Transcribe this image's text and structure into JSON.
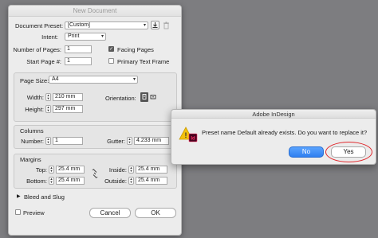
{
  "new_document": {
    "title": "New Document",
    "preset_label": "Document Preset:",
    "preset_value": "[Custom]",
    "intent_label": "Intent:",
    "intent_value": "Print",
    "pages_label": "Number of Pages:",
    "pages_value": "1",
    "start_page_label": "Start Page #:",
    "start_page_value": "1",
    "facing_pages_label": "Facing Pages",
    "facing_pages_checked": true,
    "primary_text_frame_label": "Primary Text Frame",
    "primary_text_frame_checked": false,
    "page_size_label": "Page Size:",
    "page_size_value": "A4",
    "width_label": "Width:",
    "width_value": "210 mm",
    "height_label": "Height:",
    "height_value": "297 mm",
    "orientation_label": "Orientation:",
    "columns_heading": "Columns",
    "number_label": "Number:",
    "number_value": "1",
    "gutter_label": "Gutter:",
    "gutter_value": "4.233 mm",
    "margins_heading": "Margins",
    "top_label": "Top:",
    "top_value": "25.4 mm",
    "bottom_label": "Bottom:",
    "bottom_value": "25.4 mm",
    "inside_label": "Inside:",
    "inside_value": "25.4 mm",
    "outside_label": "Outside:",
    "outside_value": "25.4 mm",
    "bleed_label": "Bleed and Slug",
    "preview_label": "Preview",
    "preview_checked": false,
    "cancel_label": "Cancel",
    "ok_label": "OK"
  },
  "alert": {
    "title": "Adobe InDesign",
    "message": "Preset name Default already exists. Do you want to replace it?",
    "no_label": "No",
    "yes_label": "Yes",
    "annotation_color": "#e0282d",
    "default_button_color": "#2f7ff0"
  },
  "icons": {
    "warning": "warning-triangle-icon",
    "save_preset": "save-preset-icon",
    "delete_preset": "trash-icon",
    "portrait": "portrait-orientation-icon",
    "landscape": "landscape-orientation-icon",
    "link": "chain-link-icon"
  }
}
